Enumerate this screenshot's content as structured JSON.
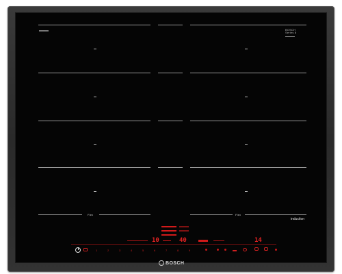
{
  "appliance": {
    "type": "induction hob",
    "brand": "BOSCH",
    "top_logo_line1": "BOSCH",
    "top_logo_line2": "Series 8",
    "flex_left": "Flex",
    "flex_right": "Flex",
    "induction_label": "induction"
  },
  "control_panel": {
    "display_left": "10",
    "display_mid": "40",
    "display_right": "14",
    "scale_labels": [
      "1",
      "2",
      "3",
      "4",
      "5",
      "6",
      "7",
      "8",
      "9"
    ],
    "colors": {
      "accent": "#e02020",
      "glass": "#050505",
      "frame": "#333333",
      "lines": "#9a9a9a"
    }
  }
}
